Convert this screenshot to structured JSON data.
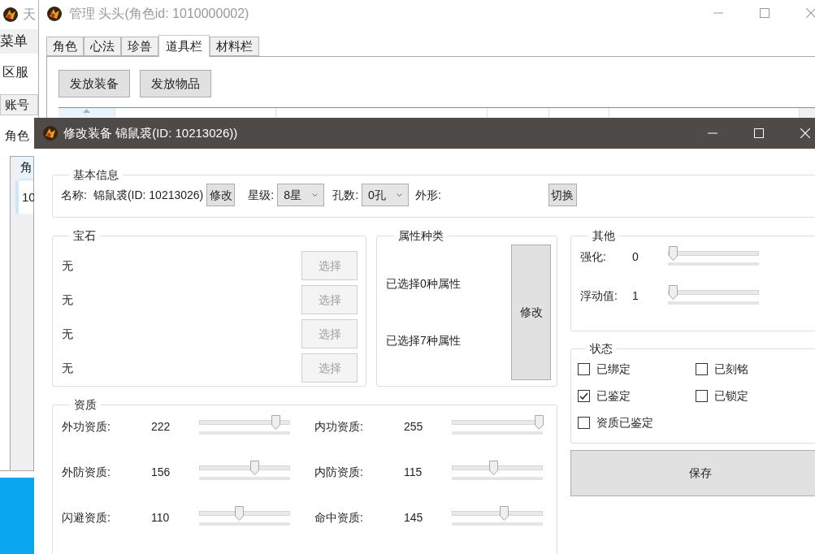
{
  "background_window": {
    "title": "天",
    "menu": "菜单",
    "server_label": "区服",
    "tab": "账号",
    "section_label": "角色",
    "table": {
      "column_1": "角",
      "rows": [
        [
          "10"
        ]
      ]
    }
  },
  "manager_window": {
    "title": "管理 头头(角色id: 1010000002)",
    "tabs": [
      {
        "label": "角色",
        "selected": false
      },
      {
        "label": "心法",
        "selected": false
      },
      {
        "label": "珍兽",
        "selected": false
      },
      {
        "label": "道具栏",
        "selected": true
      },
      {
        "label": "材料栏",
        "selected": false
      }
    ],
    "buttons": [
      "发放装备",
      "发放物品"
    ]
  },
  "dialog": {
    "title": "修改装备 锦鼠裘(ID: 10213026))",
    "basic_info": {
      "title": "基本信息",
      "name_label": "名称:",
      "name": "锦鼠裘(ID: 10213026)",
      "edit_button": "修改",
      "star_label": "星级:",
      "star": "8星",
      "holes_label": "孔数:",
      "holes": "0孔",
      "appearance_label": "外形:",
      "switch_button": "切换"
    },
    "gems": {
      "title": "宝石",
      "rows": [
        {
          "value": "无",
          "button": "选择",
          "disabled": true
        },
        {
          "value": "无",
          "button": "选择",
          "disabled": true
        },
        {
          "value": "无",
          "button": "选择",
          "disabled": true
        },
        {
          "value": "无",
          "button": "选择",
          "disabled": true
        }
      ]
    },
    "attributes": {
      "title": "属性种类",
      "lines": [
        "已选择0种属性",
        "已选择7种属性"
      ],
      "button": "修改"
    },
    "other": {
      "title": "其他",
      "rows": [
        {
          "label": "强化:",
          "value": "0",
          "level": 0
        },
        {
          "label": "浮动值:",
          "value": "1",
          "level": 0
        }
      ]
    },
    "status": {
      "title": "状态",
      "checkboxes": [
        {
          "label": "已绑定",
          "checked": false
        },
        {
          "label": "已刻铭",
          "checked": false
        },
        {
          "label": "已鉴定",
          "checked": true
        },
        {
          "label": "已锁定",
          "checked": false
        },
        {
          "label": "资质已鉴定",
          "checked": false
        }
      ]
    },
    "save_button": "保存",
    "aptitude": {
      "title": "资质",
      "rows": [
        {
          "label": "外功资质:",
          "value": "222",
          "level": 0.87
        },
        {
          "label": "内功资质:",
          "value": "255",
          "level": 1
        },
        {
          "label": "外防资质:",
          "value": "156",
          "level": 0.61
        },
        {
          "label": "内防资质:",
          "value": "115",
          "level": 0.45
        },
        {
          "label": "闪避资质:",
          "value": "110",
          "level": 0.43
        },
        {
          "label": "命中资质:",
          "value": "145",
          "level": 0.57
        }
      ]
    }
  }
}
